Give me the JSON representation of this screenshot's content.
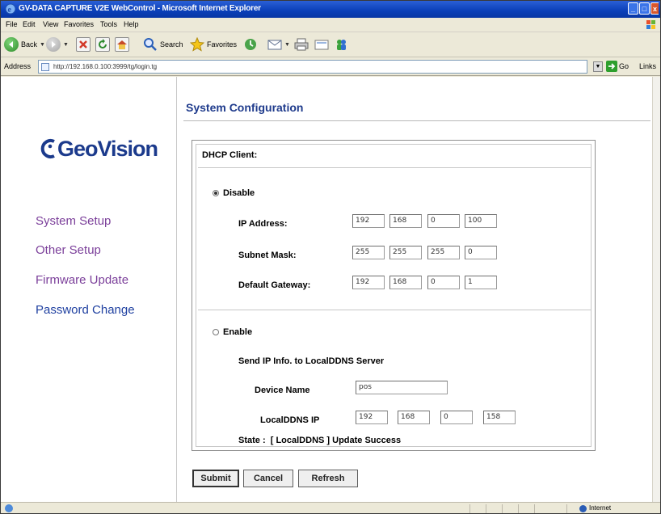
{
  "window": {
    "title": "GV-DATA CAPTURE V2E WebControl - Microsoft Internet Explorer",
    "controls": {
      "minimize": "_",
      "maximize": "□",
      "close": "x"
    }
  },
  "menu": [
    "File",
    "Edit",
    "View",
    "Favorites",
    "Tools",
    "Help"
  ],
  "toolbar": {
    "back": "Back",
    "search": "Search",
    "favorites": "Favorites"
  },
  "address": {
    "label": "Address",
    "url": "http://192.168.0.100:3999/tg/login.tg",
    "go": "Go",
    "links": "Links"
  },
  "brand": {
    "name": "GeoVision"
  },
  "nav": [
    {
      "label": "System Setup"
    },
    {
      "label": "Other Setup"
    },
    {
      "label": "Firmware Update"
    },
    {
      "label": "Password Change"
    }
  ],
  "page": {
    "title": "System Configuration",
    "dhcp_label": "DHCP Client:",
    "disable": {
      "label": "Disable",
      "selected": true,
      "ip_label": "IP Address:",
      "ip": [
        "192",
        "168",
        "0",
        "100"
      ],
      "mask_label": "Subnet Mask:",
      "mask": [
        "255",
        "255",
        "255",
        "0"
      ],
      "gateway_label": "Default Gateway:",
      "gateway": [
        "192",
        "168",
        "0",
        "1"
      ]
    },
    "enable": {
      "label": "Enable",
      "selected": false,
      "send_info": "Send IP Info. to LocalDDNS Server",
      "device_label": "Device Name",
      "device_name": "pos",
      "ddns_label": "LocalDDNS IP",
      "ddns_ip": [
        "192",
        "168",
        "0",
        "158"
      ],
      "state": "State :  [ LocalDDNS ] Update Success"
    },
    "buttons": {
      "submit": "Submit",
      "cancel": "Cancel",
      "refresh": "Refresh"
    }
  },
  "status": {
    "zone": "Internet"
  }
}
